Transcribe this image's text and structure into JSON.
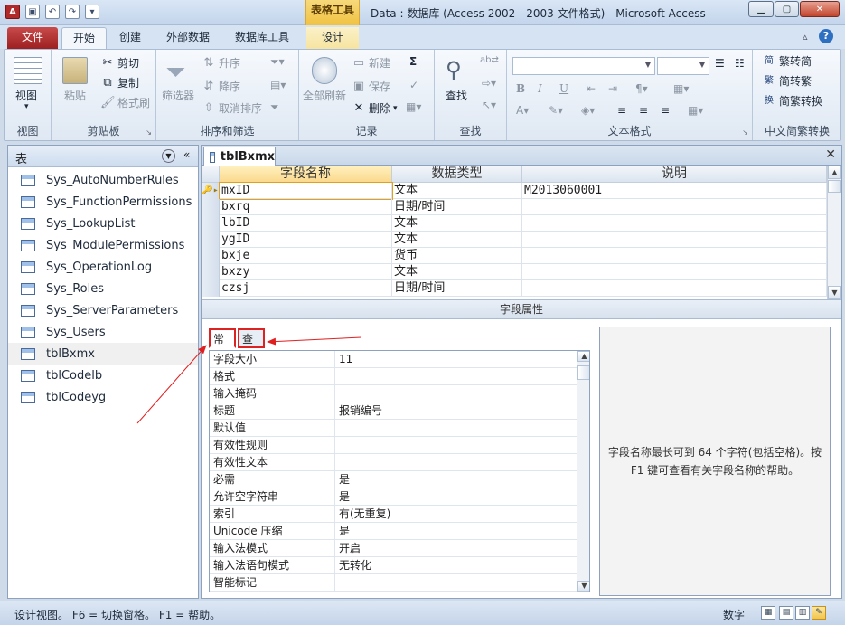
{
  "window": {
    "title": "Data : 数据库 (Access 2002 - 2003 文件格式) - Microsoft Access",
    "context_group": "表格工具"
  },
  "tabs": [
    "文件",
    "开始",
    "创建",
    "外部数据",
    "数据库工具",
    "设计"
  ],
  "ribbon": {
    "view": {
      "button": "视图",
      "label": "视图"
    },
    "clipboard": {
      "paste": "粘贴",
      "cut": "剪切",
      "copy": "复制",
      "format_painter": "格式刷",
      "label": "剪贴板"
    },
    "sort_filter": {
      "filter": "筛选器",
      "ascending": "升序",
      "descending": "降序",
      "clear_sort": "取消排序",
      "label": "排序和筛选"
    },
    "records": {
      "refresh_all": "全部刷新",
      "new": "新建",
      "save": "保存",
      "delete": "删除",
      "label": "记录"
    },
    "find": {
      "find": "查找",
      "label": "查找"
    },
    "text_format": {
      "label": "文本格式"
    },
    "chinese_conversion": {
      "to_simplified": "繁转简",
      "to_traditional": "简转繁",
      "convert": "简繁转换",
      "label": "中文简繁转换"
    }
  },
  "nav": {
    "header": "表",
    "items": [
      "Sys_AutoNumberRules",
      "Sys_FunctionPermissions",
      "Sys_LookupList",
      "Sys_ModulePermissions",
      "Sys_OperationLog",
      "Sys_Roles",
      "Sys_ServerParameters",
      "Sys_Users",
      "tblBxmx",
      "tblCodelb",
      "tblCodeyg"
    ],
    "selected": "tblBxmx"
  },
  "document": {
    "tab_title": "tblBxmx",
    "columns": [
      "字段名称",
      "数据类型",
      "说明"
    ],
    "rows": [
      {
        "name": "mxID",
        "type": "文本",
        "desc": "M2013060001",
        "key": true
      },
      {
        "name": "bxrq",
        "type": "日期/时间",
        "desc": ""
      },
      {
        "name": "lbID",
        "type": "文本",
        "desc": ""
      },
      {
        "name": "ygID",
        "type": "文本",
        "desc": ""
      },
      {
        "name": "bxje",
        "type": "货币",
        "desc": ""
      },
      {
        "name": "bxzy",
        "type": "文本",
        "desc": ""
      },
      {
        "name": "czsj",
        "type": "日期/时间",
        "desc": ""
      }
    ],
    "properties_bar": "字段属性",
    "prop_tabs": [
      "常规",
      "查阅"
    ],
    "properties": [
      {
        "k": "字段大小",
        "v": "11"
      },
      {
        "k": "格式",
        "v": ""
      },
      {
        "k": "输入掩码",
        "v": ""
      },
      {
        "k": "标题",
        "v": "报销编号"
      },
      {
        "k": "默认值",
        "v": ""
      },
      {
        "k": "有效性规则",
        "v": ""
      },
      {
        "k": "有效性文本",
        "v": ""
      },
      {
        "k": "必需",
        "v": "是"
      },
      {
        "k": "允许空字符串",
        "v": "是"
      },
      {
        "k": "索引",
        "v": "有(无重复)"
      },
      {
        "k": "Unicode 压缩",
        "v": "是"
      },
      {
        "k": "输入法模式",
        "v": "开启"
      },
      {
        "k": "输入法语句模式",
        "v": "无转化"
      },
      {
        "k": "智能标记",
        "v": ""
      }
    ],
    "help_text": "字段名称最长可到 64 个字符(包括空格)。按 F1 键可查看有关字段名称的帮助。"
  },
  "status": {
    "left": "设计视图。  F6 = 切换窗格。  F1 = 帮助。",
    "right": "数字"
  },
  "colors": {
    "file_tab": "#b02a2a",
    "context": "#f0c242",
    "annotation": "#e02020"
  }
}
